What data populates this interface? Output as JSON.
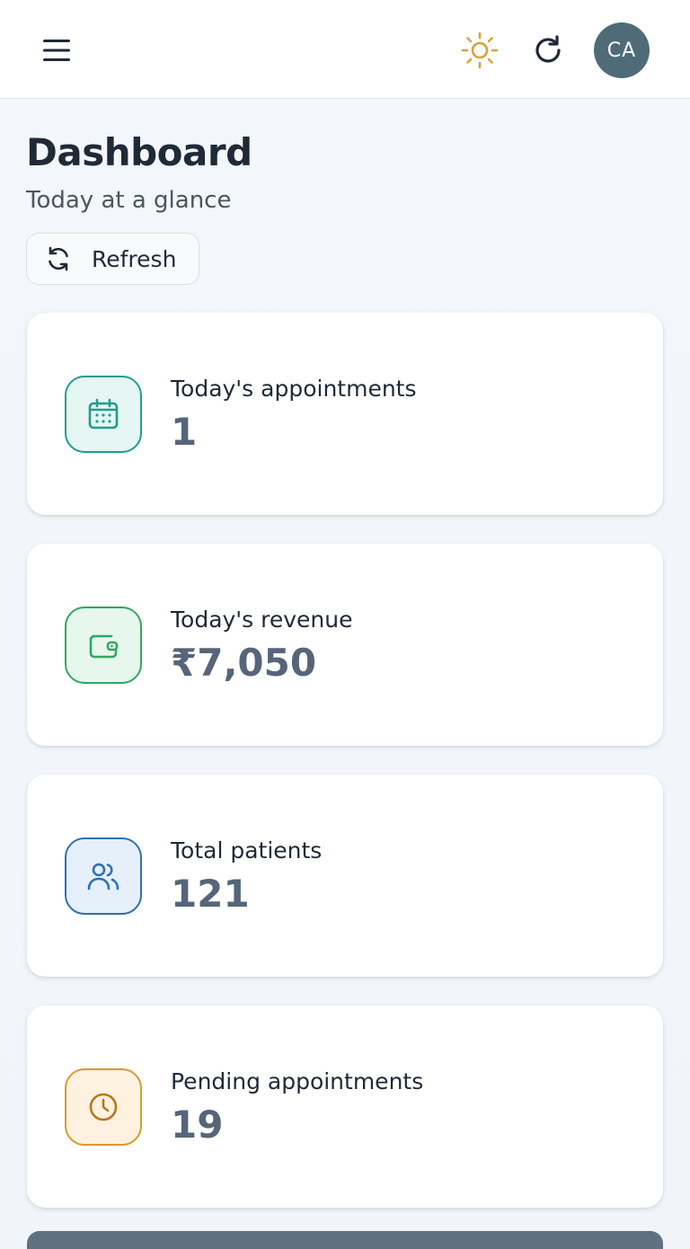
{
  "header": {
    "menu_icon": "hamburger-menu-icon",
    "theme_icon": "sun-icon",
    "reload_icon": "refresh-icon",
    "avatar_initials": "CA",
    "avatar_color": "#4f6b78"
  },
  "page": {
    "title": "Dashboard",
    "subtitle": "Today at a glance",
    "refresh_label": "Refresh"
  },
  "stats": [
    {
      "label": "Today's appointments",
      "value": "1",
      "icon": "calendar-icon",
      "color": "#1f9d8f",
      "bg": "#e6f6f3"
    },
    {
      "label": "Today's revenue",
      "value": "₹7,050",
      "icon": "wallet-icon",
      "color": "#2fa860",
      "bg": "#e8f7ee"
    },
    {
      "label": "Total patients",
      "value": "121",
      "icon": "users-icon",
      "color": "#2f6fb5",
      "bg": "#e6f0fb"
    },
    {
      "label": "Pending appointments",
      "value": "19",
      "icon": "clock-icon",
      "color": "#d99a2b",
      "bg": "#fdf2e0"
    }
  ]
}
